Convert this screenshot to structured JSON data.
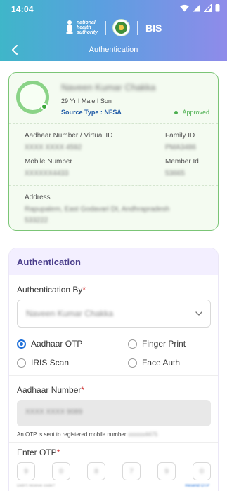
{
  "status_bar": {
    "time": "14:04",
    "icons": [
      "wifi-icon",
      "signal-icon",
      "signal-icon",
      "battery-icon"
    ]
  },
  "header": {
    "logo_text": [
      "national",
      "health",
      "authority"
    ],
    "brand": "BIS",
    "title": "Authentication"
  },
  "profile": {
    "name": "Naveen Kumar Chakka",
    "meta": "29 Yr  I  Male  I  Son",
    "source_type": "Source Type : NFSA",
    "status": "Approved",
    "aadhaar_label": "Aadhaar Number / Virtual ID",
    "aadhaar_value": "XXXX XXXX 4592",
    "family_label": "Family ID",
    "family_value": "PMA3486",
    "mobile_label": "Mobile Number",
    "mobile_value": "XXXXXX4433",
    "member_label": "Member Id",
    "member_value": "53665",
    "address_label": "Address",
    "address_line1": "Rapupalem, East Godavari Dt, Andhrapradesh",
    "address_line2": "533222"
  },
  "auth": {
    "title": "Authentication",
    "by_label": "Authentication By",
    "required_mark": "*",
    "selected_member": "Naveen Kumar Chakka",
    "options": {
      "aadhaar_otp": "Aadhaar OTP",
      "finger_print": "Finger Print",
      "iris_scan": "IRIS Scan",
      "face_auth": "Face Auth"
    },
    "selected_option": "Aadhaar OTP",
    "aadhaar_label": "Aadhaar Number",
    "aadhaar_value": "XXXX XXXX 9089",
    "otp_note": "An OTP is sent to registered mobile number",
    "otp_note_masked": "xxxxxx4475",
    "otp_label": "Enter OTP",
    "otp_digits": [
      "9",
      "0",
      "8",
      "7",
      "9",
      "0"
    ],
    "otp_footer_left": "Didn't receive code?",
    "otp_footer_right": "Resend OTP"
  },
  "colors": {
    "accent": "#1e6fd9",
    "approved": "#4caf50",
    "auth_title": "#4b3f8c",
    "card_border": "#7bc576"
  }
}
